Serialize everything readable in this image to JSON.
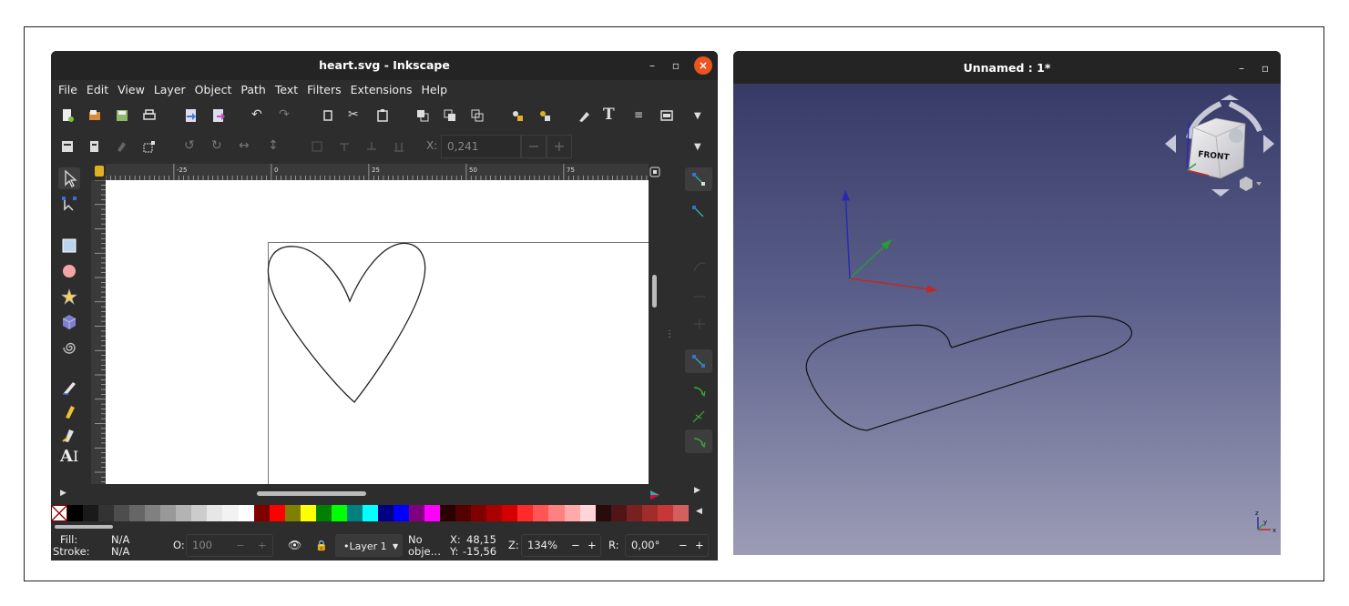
{
  "inkscape": {
    "title": "heart.svg - Inkscape",
    "menu": [
      "File",
      "Edit",
      "View",
      "Layer",
      "Object",
      "Path",
      "Text",
      "Filters",
      "Extensions",
      "Help"
    ],
    "x_label": "X:",
    "x_value": "0,241",
    "ruler_ticks": [
      "-25",
      "0",
      "25",
      "50",
      "75"
    ],
    "status": {
      "fill_label": "Fill:",
      "fill_value": "N/A",
      "stroke_label": "Stroke:",
      "stroke_value": "N/A",
      "opacity_label": "O:",
      "opacity_value": "100",
      "layer": "•Layer 1",
      "no_objects_1": "No",
      "no_objects_2": "obje…",
      "x_label": "X:",
      "x_value": "48,15",
      "y_label": "Y:",
      "y_value": "-15,56",
      "zoom_label": "Z:",
      "zoom_value": "134%",
      "rotation_label": "R:",
      "rotation_value": "0,00°"
    },
    "palette": [
      "#000000",
      "#1a1a1a",
      "#333333",
      "#4d4d4d",
      "#666666",
      "#808080",
      "#999999",
      "#b3b3b3",
      "#cccccc",
      "#e6e6e6",
      "#f2f2f2",
      "#ffffff",
      "#800000",
      "#ff0000",
      "#808000",
      "#ffff00",
      "#008000",
      "#00ff00",
      "#008080",
      "#00ffff",
      "#000080",
      "#0000ff",
      "#800080",
      "#ff00ff",
      "#2b0000",
      "#550000",
      "#800000",
      "#aa0000",
      "#d40000",
      "#ff2a2a",
      "#ff5555",
      "#ff8080",
      "#ffaaaa",
      "#ffd5d5",
      "#280b0b",
      "#501616",
      "#782121",
      "#a02c2c",
      "#c83737",
      "#d35f5f"
    ]
  },
  "freecad": {
    "title": "Unnamed : 1*",
    "navcube_face": "FRONT"
  }
}
